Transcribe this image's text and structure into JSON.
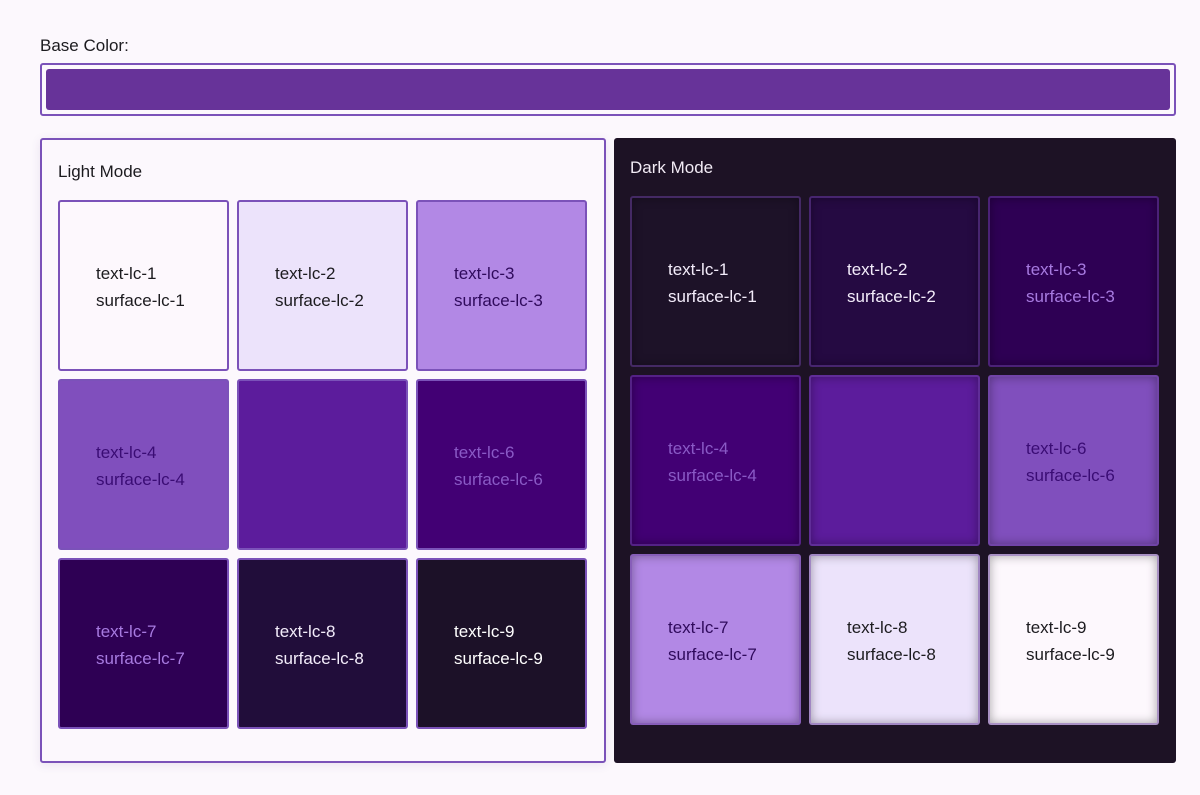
{
  "base_color": {
    "label": "Base Color:",
    "value": "#673399"
  },
  "light_mode": {
    "title": "Light Mode",
    "tiles": [
      {
        "text": "text-lc-1",
        "surface": "surface-lc-1",
        "bg": "#fdf8fd",
        "fg": "#1c1b1f"
      },
      {
        "text": "text-lc-2",
        "surface": "surface-lc-2",
        "bg": "#ece3fb",
        "fg": "#1c1b1f"
      },
      {
        "text": "text-lc-3",
        "surface": "surface-lc-3",
        "bg": "#b288e5",
        "fg": "#2f0a5c"
      },
      {
        "text": "text-lc-4",
        "surface": "surface-lc-4",
        "bg": "#804fbd",
        "fg": "#3a0c74"
      },
      {
        "text": "",
        "surface": "",
        "bg": "#5c1c9c",
        "fg": "#5c1c9c"
      },
      {
        "text": "text-lc-6",
        "surface": "surface-lc-6",
        "bg": "#420074",
        "fg": "#8a5ac6"
      },
      {
        "text": "text-lc-7",
        "surface": "surface-lc-7",
        "bg": "#2e0054",
        "fg": "#a77ae0"
      },
      {
        "text": "text-lc-8",
        "surface": "surface-lc-8",
        "bg": "#210d3a",
        "fg": "#f3ecfa"
      },
      {
        "text": "text-lc-9",
        "surface": "surface-lc-9",
        "bg": "#1c1128",
        "fg": "#ffffff"
      }
    ]
  },
  "dark_mode": {
    "title": "Dark Mode",
    "tiles": [
      {
        "text": "text-lc-1",
        "surface": "surface-lc-1",
        "bg": "#1d1228",
        "fg": "#f3ecfa"
      },
      {
        "text": "text-lc-2",
        "surface": "surface-lc-2",
        "bg": "#250a42",
        "fg": "#f3ecfa"
      },
      {
        "text": "text-lc-3",
        "surface": "surface-lc-3",
        "bg": "#2e0054",
        "fg": "#a77ae0"
      },
      {
        "text": "text-lc-4",
        "surface": "surface-lc-4",
        "bg": "#420074",
        "fg": "#8a5ac6"
      },
      {
        "text": "",
        "surface": "",
        "bg": "#5c1c9c",
        "fg": "#5c1c9c"
      },
      {
        "text": "text-lc-6",
        "surface": "surface-lc-6",
        "bg": "#804fbd",
        "fg": "#3a0c74"
      },
      {
        "text": "text-lc-7",
        "surface": "surface-lc-7",
        "bg": "#b288e5",
        "fg": "#2f0a5c"
      },
      {
        "text": "text-lc-8",
        "surface": "surface-lc-8",
        "bg": "#ece3fb",
        "fg": "#1c1b1f"
      },
      {
        "text": "text-lc-9",
        "surface": "surface-lc-9",
        "bg": "#fdf8fd",
        "fg": "#1c1b1f"
      }
    ]
  }
}
